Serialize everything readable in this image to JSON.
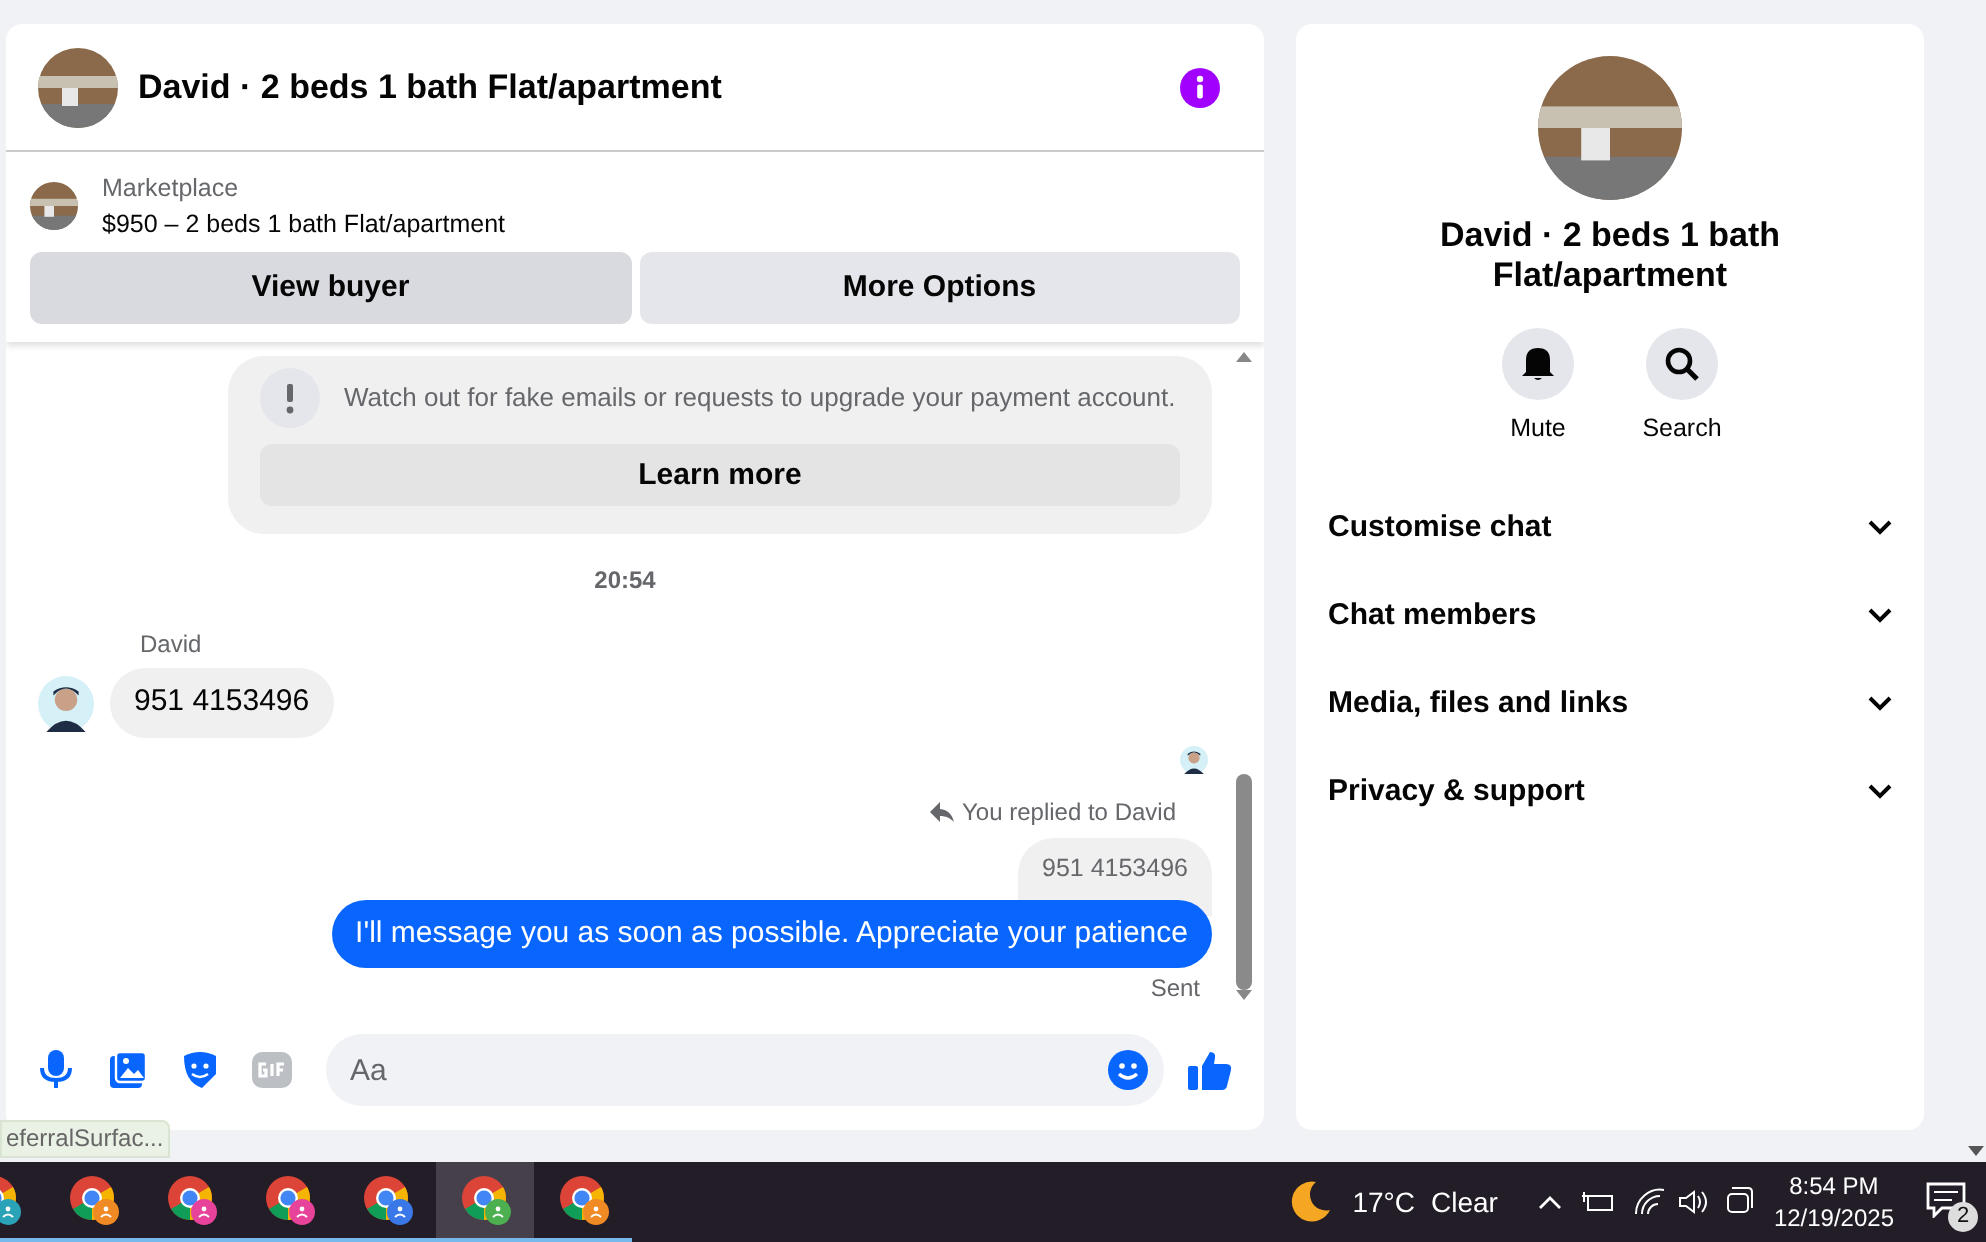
{
  "chat": {
    "title": "David · 2 beds 1 bath Flat/apartment",
    "listing": {
      "source": "Marketplace",
      "summary": "$950 – 2 beds 1 bath Flat/apartment"
    },
    "actions": [
      {
        "label": "View buyer",
        "hovered": true
      },
      {
        "label": "More Options",
        "hovered": false
      }
    ],
    "messages": [
      {
        "kind": "notice",
        "text": "Watch out for fake emails or requests to upgrade your payment account.",
        "button": "Learn more"
      },
      {
        "kind": "timestamp",
        "text": "20:54"
      },
      {
        "kind": "incoming",
        "sender": "David",
        "text": "951 4153496"
      },
      {
        "kind": "read_receipt"
      },
      {
        "kind": "outgoing",
        "reply_label": "You replied to David",
        "quoted": "951 4153496",
        "text": "I'll message you as soon as possible. Appreciate your patience",
        "status": "Sent"
      }
    ],
    "composer": {
      "placeholder": "Aa"
    }
  },
  "details": {
    "title": "David · 2 beds 1 bath Flat/apartment",
    "actions": [
      {
        "kind": "bell",
        "label": "Mute"
      },
      {
        "kind": "search",
        "label": "Search"
      }
    ],
    "sections": [
      {
        "label": "Customise chat",
        "expanded": false
      },
      {
        "label": "Chat members",
        "expanded": false
      },
      {
        "label": "Media, files and links",
        "expanded": false
      },
      {
        "label": "Privacy & support",
        "expanded": false
      }
    ]
  },
  "status_tooltip": "eferralSurfac...",
  "taskbar": {
    "apps": [
      {
        "color": "#2aa3b8",
        "selected": false
      },
      {
        "color": "#f08a24",
        "selected": false
      },
      {
        "color": "#e8439a",
        "selected": false
      },
      {
        "color": "#e8439a",
        "selected": false
      },
      {
        "color": "#3b78e7",
        "selected": false
      },
      {
        "color": "#4caf50",
        "selected": true
      },
      {
        "color": "#f08a24",
        "selected": false
      }
    ],
    "weather": {
      "temperature": "17°C",
      "condition": "Clear"
    },
    "clock": {
      "time": "8:54 PM",
      "date": "12/19/2025"
    },
    "notifications": {
      "count": "2"
    }
  }
}
